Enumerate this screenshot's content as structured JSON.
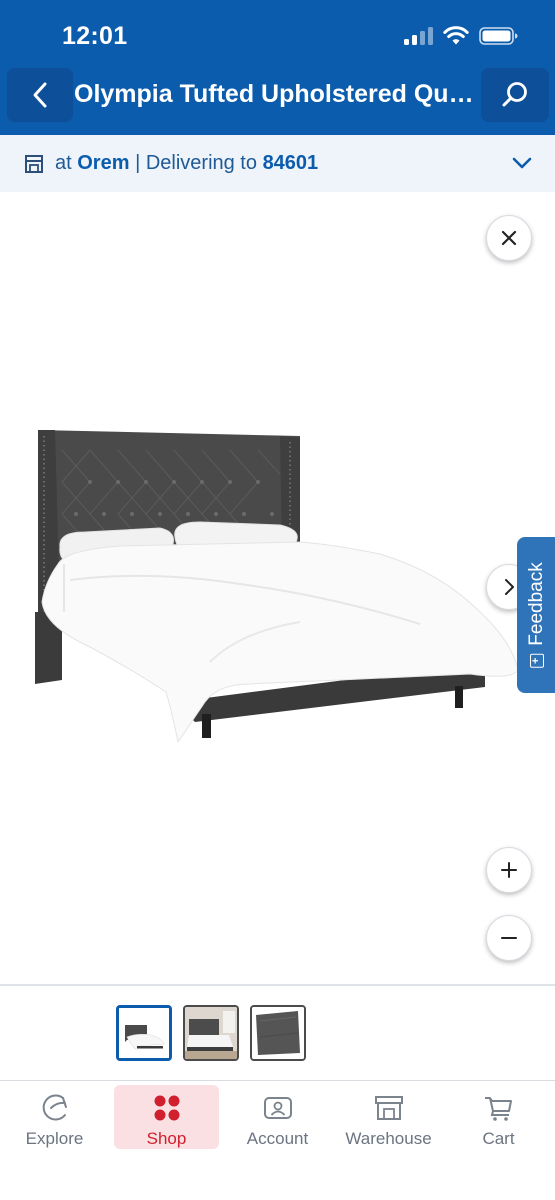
{
  "status_bar": {
    "time": "12:01"
  },
  "header": {
    "title": "Olympia Tufted Upholstered Queen Bed",
    "back_icon": "chevron-left-icon",
    "search_icon": "search-icon"
  },
  "delivery": {
    "prefix": "at",
    "store": "Orem",
    "separator": "|",
    "delivering_label": "Delivering to",
    "zip": "84601"
  },
  "gallery": {
    "close_icon": "close-icon",
    "next_icon": "chevron-right-icon",
    "zoom_in_icon": "plus-icon",
    "zoom_out_icon": "minus-icon",
    "feedback_label": "Feedback",
    "thumbnails": [
      {
        "name": "bed-front-angle",
        "selected": true
      },
      {
        "name": "bed-room-scene",
        "selected": false
      },
      {
        "name": "fabric-swatch",
        "selected": false
      }
    ]
  },
  "tabbar": {
    "tabs": [
      {
        "label": "Explore",
        "icon": "explore-icon"
      },
      {
        "label": "Shop",
        "icon": "shop-icon",
        "active": true
      },
      {
        "label": "Account",
        "icon": "account-icon"
      },
      {
        "label": "Warehouse",
        "icon": "warehouse-icon"
      },
      {
        "label": "Cart",
        "icon": "cart-icon"
      }
    ]
  },
  "colors": {
    "header_blue": "#0b5cad",
    "active_red": "#d0202e",
    "feedback_blue": "#2f73b9"
  }
}
